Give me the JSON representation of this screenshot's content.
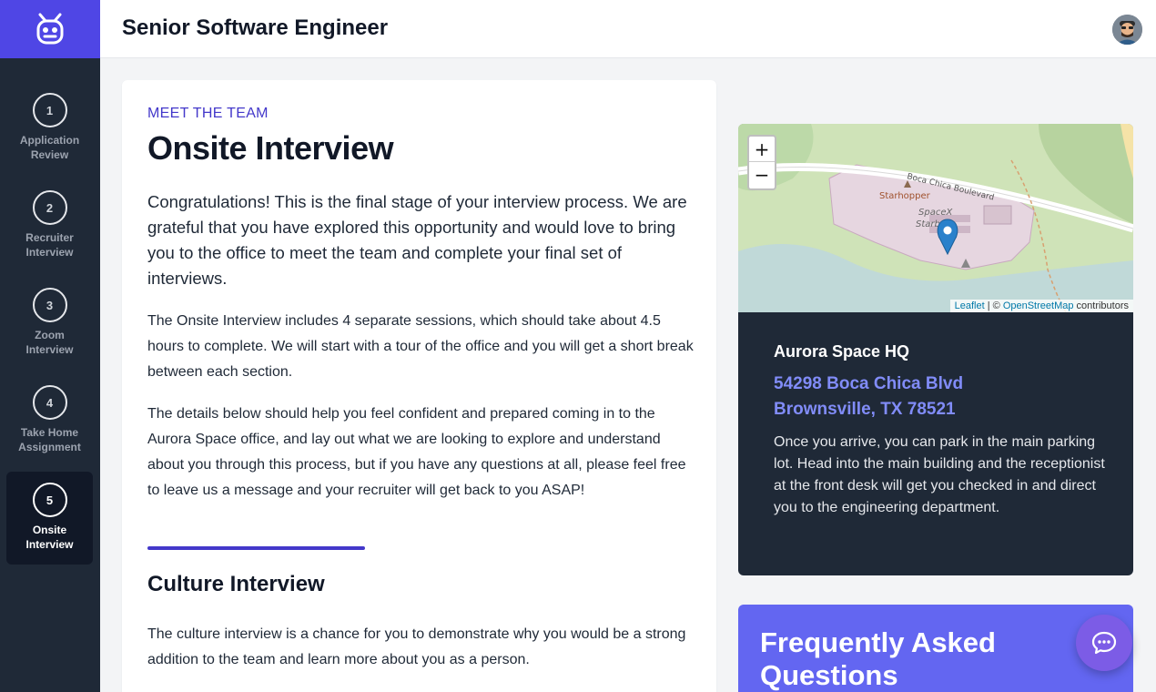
{
  "header": {
    "title": "Senior Software Engineer"
  },
  "sidebar": {
    "steps": [
      {
        "number": "1",
        "label_line1": "Application",
        "label_line2": "Review",
        "active": false
      },
      {
        "number": "2",
        "label_line1": "Recruiter",
        "label_line2": "Interview",
        "active": false
      },
      {
        "number": "3",
        "label_line1": "Zoom",
        "label_line2": "Interview",
        "active": false
      },
      {
        "number": "4",
        "label_line1": "Take Home",
        "label_line2": "Assignment",
        "active": false
      },
      {
        "number": "5",
        "label_line1": "Onsite",
        "label_line2": "Interview",
        "active": true
      }
    ]
  },
  "main": {
    "eyebrow": "MEET THE TEAM",
    "title": "Onsite Interview",
    "lead": "Congratulations! This is the final stage of your interview process. We are grateful that you have explored this opportunity and would love to bring you to the office to meet the team and complete your final set of interviews.",
    "para1": "The Onsite Interview includes 4 separate sessions, which should take about 4.5 hours to complete. We will start with a tour of the office and you will get a short break between each section.",
    "para2": "The details below should help you feel confident and prepared coming in to the Aurora Space office, and lay out what we are looking to explore and understand about you through this process, but if you have any questions at all, please feel free to leave us a message and your recruiter will get back to you ASAP!",
    "section_title": "Culture Interview",
    "section_text": "The culture interview is a chance for you to demonstrate why you would be a strong addition to the team and learn more about you as a person."
  },
  "location": {
    "map": {
      "zoom_in": "+",
      "zoom_out": "−",
      "road_label": "Boca Chica Boulevard",
      "place_label_1": "Starhopper",
      "place_label_2": "SpaceX",
      "place_label_3": "Starb",
      "attribution_leaflet": "Leaflet",
      "attribution_sep": " | © ",
      "attribution_osm": "OpenStreetMap",
      "attribution_tail": " contributors"
    },
    "name": "Aurora Space HQ",
    "address_line1": "54298 Boca Chica Blvd",
    "address_line2": "Brownsville, TX 78521",
    "description": "Once you arrive, you can park in the main parking lot. Head into the main building and the receptionist at the front desk will get you checked in and direct you to the engineering department."
  },
  "faq": {
    "title": "Frequently Asked Questions"
  },
  "colors": {
    "accent": "#4f46e5",
    "sidebar": "#1f2937",
    "link": "#818cf8",
    "faq": "#6366f1"
  },
  "icons": {
    "logo": "robot-logo-icon",
    "chat": "chat-bubble-icon",
    "marker": "map-marker-icon"
  }
}
